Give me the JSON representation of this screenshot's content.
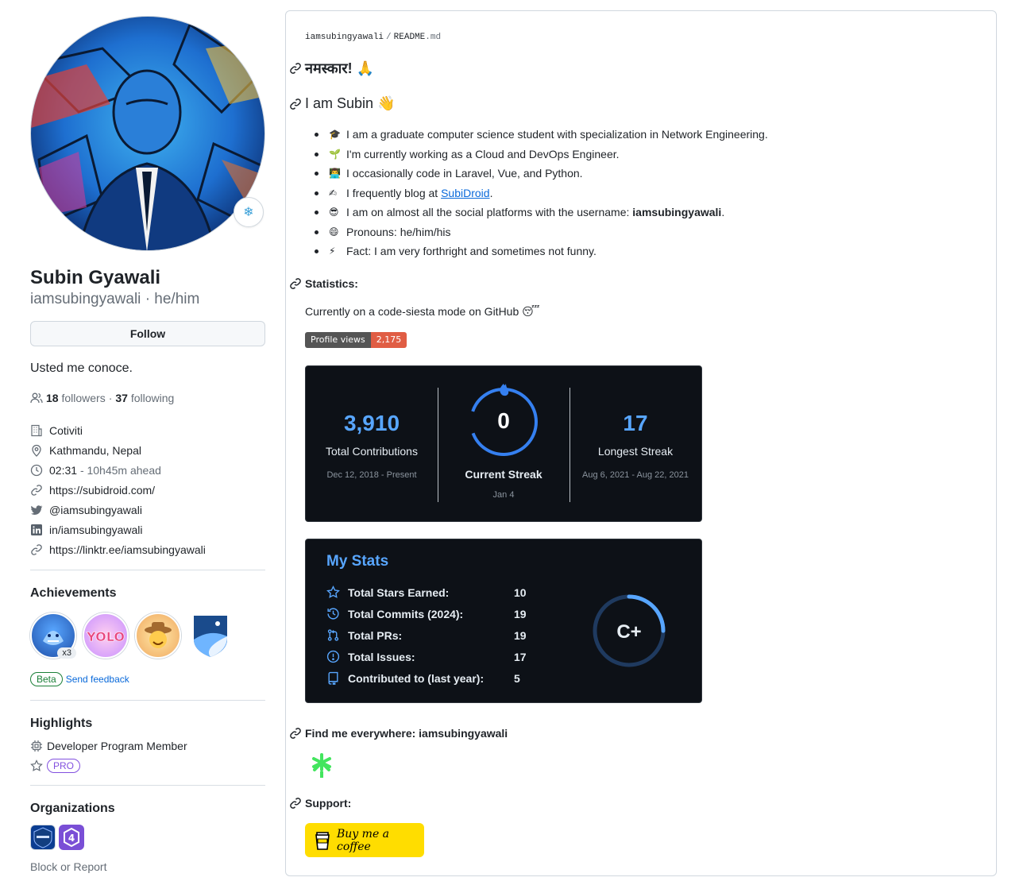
{
  "profile": {
    "name": "Subin Gyawali",
    "login": "iamsubingyawali",
    "pronouns_sep": "·",
    "pronouns": "he/him",
    "follow_label": "Follow",
    "bio": "Usted me conoce.",
    "followers_count": "18",
    "followers_label": "followers",
    "dot": "·",
    "following_count": "37",
    "following_label": "following",
    "company": "Cotiviti",
    "location": "Kathmandu, Nepal",
    "time": "02:31",
    "time_offset": "- 10h45m ahead",
    "website": "https://subidroid.com/",
    "twitter": "@iamsubingyawali",
    "linkedin": "in/iamsubingyawali",
    "linktree": "https://linktr.ee/iamsubingyawali"
  },
  "achievements": {
    "title": "Achievements",
    "count_badge": "x3",
    "beta_label": "Beta",
    "feedback_label": "Send feedback"
  },
  "highlights": {
    "title": "Highlights",
    "developer_program": "Developer Program Member",
    "pro_label": "PRO"
  },
  "organizations": {
    "title": "Organizations",
    "block_label": "Block or Report"
  },
  "readme": {
    "breadcrumb_user": "iamsubingyawali",
    "breadcrumb_sep": "/",
    "breadcrumb_file": "README",
    "breadcrumb_ext": ".md",
    "greeting": "नमस्कार! 🙏",
    "intro": "I am Subin 👋",
    "bullets": [
      {
        "emoji": "🎓",
        "text": "I am a graduate computer science student with specialization in Network Engineering."
      },
      {
        "emoji": "🌱",
        "text": "I'm currently working as a Cloud and DevOps Engineer."
      },
      {
        "emoji": "👨‍💻",
        "text": "I occasionally code in Laravel, Vue, and Python."
      },
      {
        "emoji": "✍",
        "text": "I frequently blog at ",
        "link": "SubiDroid",
        "after": "."
      },
      {
        "emoji": "😎",
        "text": "I am on almost all the social platforms with the username: ",
        "bold": "iamsubingyawali",
        "after": "."
      },
      {
        "emoji": "😄",
        "text": "Pronouns: he/him/his"
      },
      {
        "emoji": "⚡",
        "text": "Fact: I am very forthright and sometimes not funny."
      }
    ],
    "statistics_heading": "Statistics:",
    "siesta_text": "Currently on a code-siesta mode on GitHub 😴",
    "profile_views_label": "Profile views",
    "profile_views_value": "2,175",
    "find_me_heading": "Find me everywhere: iamsubingyawali",
    "support_heading": "Support:",
    "bmc_label": "Buy me a coffee"
  },
  "streak": {
    "total": "3,910",
    "total_label": "Total Contributions",
    "total_range": "Dec 12, 2018 - Present",
    "current": "0",
    "current_label": "Current Streak",
    "current_date": "Jan 4",
    "longest": "17",
    "longest_label": "Longest Streak",
    "longest_range": "Aug 6, 2021 - Aug 22, 2021"
  },
  "stats": {
    "title": "My Stats",
    "rows": [
      {
        "icon": "star-icon",
        "label": "Total Stars Earned:",
        "value": "10"
      },
      {
        "icon": "history-icon",
        "label": "Total Commits (2024):",
        "value": "19"
      },
      {
        "icon": "pull-request-icon",
        "label": "Total PRs:",
        "value": "19"
      },
      {
        "icon": "issue-icon",
        "label": "Total Issues:",
        "value": "17"
      },
      {
        "icon": "repo-icon",
        "label": "Contributed to (last year):",
        "value": "5"
      }
    ],
    "rank": "C+",
    "rank_progress": 0.25
  },
  "colors": {
    "accent": "#58a6ff",
    "card_bg": "#0d1117",
    "link": "#0969da",
    "bmc_yellow": "#ffdd00",
    "linktree_green": "#43e55e"
  }
}
